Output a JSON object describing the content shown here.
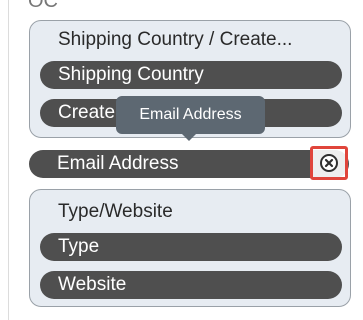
{
  "top_fragment": "ОС",
  "groups": [
    {
      "title": "Shipping Country / Create...",
      "fields": [
        "Shipping Country",
        "Create"
      ]
    },
    {
      "title": "Type/Website",
      "fields": [
        "Type",
        "Website"
      ]
    }
  ],
  "standalone_field": {
    "label": "Email Address"
  },
  "tooltip": {
    "text": "Email Address"
  },
  "icons": {
    "remove": "close-circle-icon"
  },
  "colors": {
    "pill": "#4f4f4f",
    "group_bg": "#e7ecf2",
    "highlight": "#e0453b",
    "tooltip_bg": "#5d6872"
  }
}
